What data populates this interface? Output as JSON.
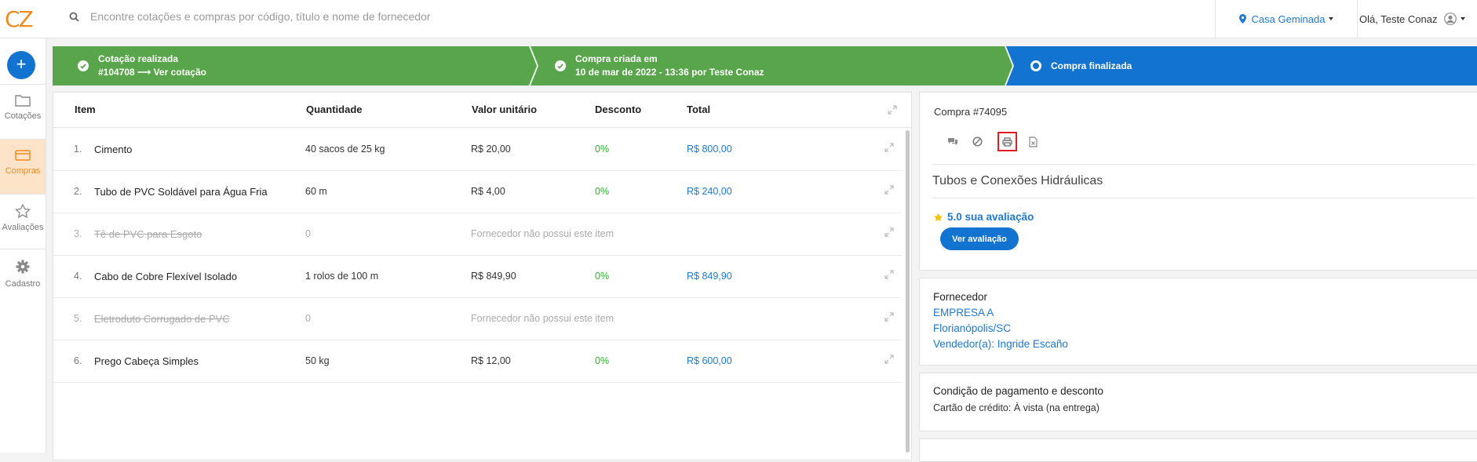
{
  "header": {
    "logo": "CZ",
    "search_placeholder": "Encontre cotações e compras por código, título e nome de fornecedor",
    "location": "Casa Geminada",
    "user_greeting": "Olá, Teste Conaz"
  },
  "sidebar": {
    "new_label": "+",
    "items": [
      {
        "label": "Cotações",
        "icon": "folder-icon"
      },
      {
        "label": "Compras",
        "icon": "card-icon"
      },
      {
        "label": "Avaliações",
        "icon": "star-icon"
      },
      {
        "label": "Cadastro",
        "icon": "gear-icon"
      }
    ]
  },
  "steps": [
    {
      "title": "Cotação realizada",
      "subtitle": "#104708 ⟶ Ver cotação",
      "color": "#58a54b"
    },
    {
      "title": "Compra criada em",
      "subtitle": "10 de mar de 2022 - 13:36 por Teste Conaz",
      "color": "#58a54b"
    },
    {
      "title": "Compra finalizada",
      "color": "#1373d1"
    }
  ],
  "table": {
    "columns": [
      "Item",
      "Quantidade",
      "Valor unitário",
      "Desconto",
      "Total"
    ],
    "rows": [
      {
        "num": "1.",
        "name": "Cimento",
        "qty": "40 sacos de 25 kg",
        "unit": "R$ 20,00",
        "disc": "0%",
        "total": "R$ 800,00",
        "struck": false
      },
      {
        "num": "2.",
        "name": "Tubo de PVC Soldável para Água Fria",
        "qty": "60 m",
        "unit": "R$ 4,00",
        "disc": "0%",
        "total": "R$ 240,00",
        "struck": false
      },
      {
        "num": "3.",
        "name": "Tê de PVC para Esgoto",
        "qty": "0",
        "msg": "Fornecedor não possui este item",
        "struck": true
      },
      {
        "num": "4.",
        "name": "Cabo de Cobre Flexível Isolado",
        "qty": "1 rolos de 100 m",
        "unit": "R$ 849,90",
        "disc": "0%",
        "total": "R$ 849,90",
        "struck": false
      },
      {
        "num": "5.",
        "name": "Eletroduto Corrugado de PVC",
        "qty": "0",
        "msg": "Fornecedor não possui este item",
        "struck": true
      },
      {
        "num": "6.",
        "name": "Prego Cabeça Simples",
        "qty": "50 kg",
        "unit": "R$ 12,00",
        "disc": "0%",
        "total": "R$ 600,00",
        "struck": false
      }
    ]
  },
  "purchase": {
    "title": "Compra #74095",
    "supplier_title": "Tubos e Conexões Hidráulicas",
    "rating": "5.0 sua avaliação",
    "rating_button": "Ver avaliação"
  },
  "supplier": {
    "heading": "Fornecedor",
    "company": "EMPRESA A",
    "city": "Florianópolis/SC",
    "seller": "Vendedor(a): Ingride Escaño"
  },
  "payment": {
    "heading": "Condição de pagamento e desconto",
    "detail": "Cartão de crédito: À vista (na entrega)"
  }
}
